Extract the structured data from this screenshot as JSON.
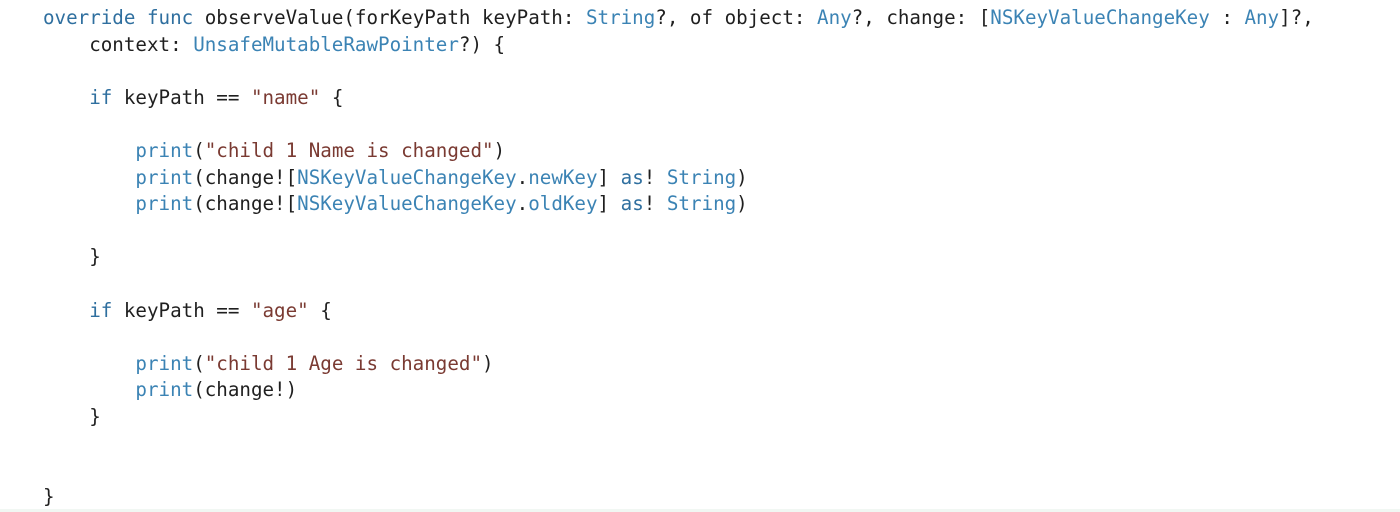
{
  "editor": {
    "language": "swift",
    "lines": [
      [
        {
          "t": "override",
          "k": "kw"
        },
        {
          "t": " ",
          "k": "pl"
        },
        {
          "t": "func",
          "k": "kw"
        },
        {
          "t": " observeValue(forKeyPath keyPath: ",
          "k": "pl"
        },
        {
          "t": "String",
          "k": "ty"
        },
        {
          "t": "?, of object: ",
          "k": "pl"
        },
        {
          "t": "Any",
          "k": "ty"
        },
        {
          "t": "?, change: [",
          "k": "pl"
        },
        {
          "t": "NSKeyValueChangeKey",
          "k": "ty"
        },
        {
          "t": " : ",
          "k": "pl"
        },
        {
          "t": "Any",
          "k": "ty"
        },
        {
          "t": "]?,",
          "k": "pl"
        }
      ],
      [
        {
          "t": "    context: ",
          "k": "pl"
        },
        {
          "t": "UnsafeMutableRawPointer",
          "k": "ty"
        },
        {
          "t": "?) {",
          "k": "pl"
        }
      ],
      [],
      [
        {
          "t": "    ",
          "k": "pl"
        },
        {
          "t": "if",
          "k": "kw"
        },
        {
          "t": " keyPath == ",
          "k": "pl"
        },
        {
          "t": "\"name\"",
          "k": "st"
        },
        {
          "t": " {",
          "k": "pl"
        }
      ],
      [],
      [
        {
          "t": "        ",
          "k": "pl"
        },
        {
          "t": "print",
          "k": "fn"
        },
        {
          "t": "(",
          "k": "pl"
        },
        {
          "t": "\"child 1 Name is changed\"",
          "k": "st"
        },
        {
          "t": ")",
          "k": "pl"
        }
      ],
      [
        {
          "t": "        ",
          "k": "pl"
        },
        {
          "t": "print",
          "k": "fn"
        },
        {
          "t": "(change![",
          "k": "pl"
        },
        {
          "t": "NSKeyValueChangeKey",
          "k": "ty"
        },
        {
          "t": ".",
          "k": "pl"
        },
        {
          "t": "newKey",
          "k": "ty"
        },
        {
          "t": "] ",
          "k": "pl"
        },
        {
          "t": "as",
          "k": "kw"
        },
        {
          "t": "! ",
          "k": "pl"
        },
        {
          "t": "String",
          "k": "ty"
        },
        {
          "t": ")",
          "k": "pl"
        }
      ],
      [
        {
          "t": "        ",
          "k": "pl"
        },
        {
          "t": "print",
          "k": "fn"
        },
        {
          "t": "(change![",
          "k": "pl"
        },
        {
          "t": "NSKeyValueChangeKey",
          "k": "ty"
        },
        {
          "t": ".",
          "k": "pl"
        },
        {
          "t": "oldKey",
          "k": "ty"
        },
        {
          "t": "] ",
          "k": "pl"
        },
        {
          "t": "as",
          "k": "kw"
        },
        {
          "t": "! ",
          "k": "pl"
        },
        {
          "t": "String",
          "k": "ty"
        },
        {
          "t": ")",
          "k": "pl"
        }
      ],
      [],
      [
        {
          "t": "    }",
          "k": "pl"
        }
      ],
      [],
      [
        {
          "t": "    ",
          "k": "pl"
        },
        {
          "t": "if",
          "k": "kw"
        },
        {
          "t": " keyPath == ",
          "k": "pl"
        },
        {
          "t": "\"age\"",
          "k": "st"
        },
        {
          "t": " {",
          "k": "pl"
        }
      ],
      [],
      [
        {
          "t": "        ",
          "k": "pl"
        },
        {
          "t": "print",
          "k": "fn"
        },
        {
          "t": "(",
          "k": "pl"
        },
        {
          "t": "\"child 1 Age is changed\"",
          "k": "st"
        },
        {
          "t": ")",
          "k": "pl"
        }
      ],
      [
        {
          "t": "        ",
          "k": "pl"
        },
        {
          "t": "print",
          "k": "fn"
        },
        {
          "t": "(change!)",
          "k": "pl"
        }
      ],
      [
        {
          "t": "    }",
          "k": "pl"
        }
      ],
      [],
      [],
      [
        {
          "t": "}",
          "k": "pl"
        }
      ]
    ]
  },
  "colors": {
    "keyword": "#2f6f9f",
    "type": "#3b83b4",
    "string": "#7a3a32",
    "plain": "#1f1f1f",
    "background": "#ffffff"
  }
}
